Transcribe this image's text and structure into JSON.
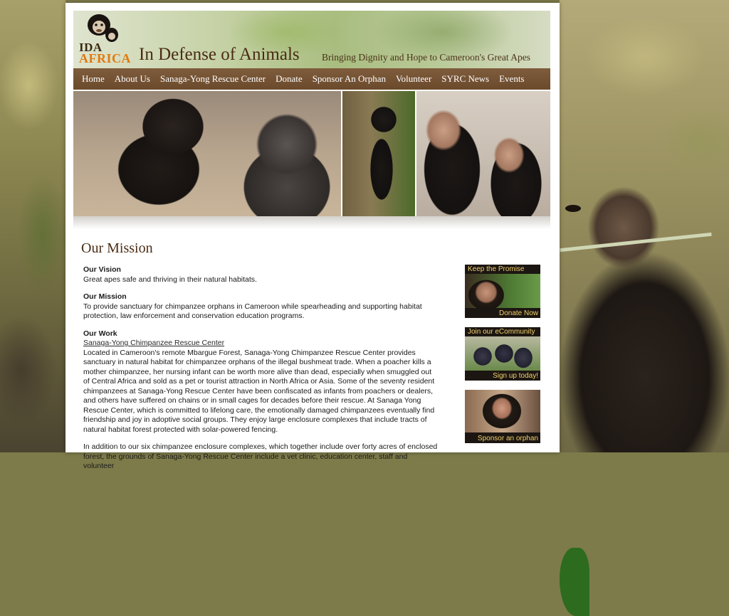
{
  "header": {
    "logo_top": "IDA",
    "logo_bottom": "AFRICA",
    "site_title": "In Defense of Animals",
    "tagline": "Bringing Dignity and Hope to Cameroon's Great Apes"
  },
  "nav": [
    {
      "label": "Home"
    },
    {
      "label": "About Us"
    },
    {
      "label": "Sanaga-Yong Rescue Center"
    },
    {
      "label": "Donate"
    },
    {
      "label": "Sponsor An Orphan"
    },
    {
      "label": "Volunteer"
    },
    {
      "label": "SYRC News"
    },
    {
      "label": "Events"
    }
  ],
  "main": {
    "title": "Our Mission",
    "vision_heading": "Our Vision",
    "vision_text": "Great apes safe and thriving in their natural habitats.",
    "mission_heading": "Our Mission",
    "mission_text": "To provide sanctuary for chimpanzee orphans in Cameroon while spearheading and supporting habitat protection, law enforcement and conservation education programs.",
    "work_heading": "Our Work",
    "work_link": "Sanaga-Yong Chimpanzee Rescue Center",
    "work_text": "Located in Cameroon's remote Mbargue Forest, Sanaga-Yong Chimpanzee Rescue Center provides sanctuary in natural habitat for chimpanzee orphans of the illegal bushmeat trade. When a poacher kills a mother chimpanzee, her nursing infant can be worth more alive than dead, especially when smuggled out of Central Africa and sold as a pet or tourist attraction in North Africa or Asia. Some of the seventy resident chimpanzees at Sanaga-Yong Rescue Center have been confiscated as infants from poachers or dealers, and others have suffered on chains or in small cages for decades before their rescue. At Sanaga Yong Rescue Center, which is committed to lifelong care, the emotionally damaged chimpanzees eventually find friendship and joy in adoptive social groups. They enjoy large enclosure complexes that include tracts of natural habitat forest protected with solar-powered fencing.",
    "work_text_2": "In addition to our six chimpanzee enclosure complexes, which together include over forty acres of enclosed forest, the grounds of Sanaga-Yong Rescue Center include a vet clinic, education center, staff and volunteer"
  },
  "sidebar": {
    "promise": {
      "top": "Keep the Promise",
      "bottom": "Donate Now"
    },
    "community": {
      "top": "Join our eCommunity",
      "bottom": "Sign up today!"
    },
    "sponsor": {
      "top": "",
      "bottom": "Sponsor an orphan"
    }
  }
}
